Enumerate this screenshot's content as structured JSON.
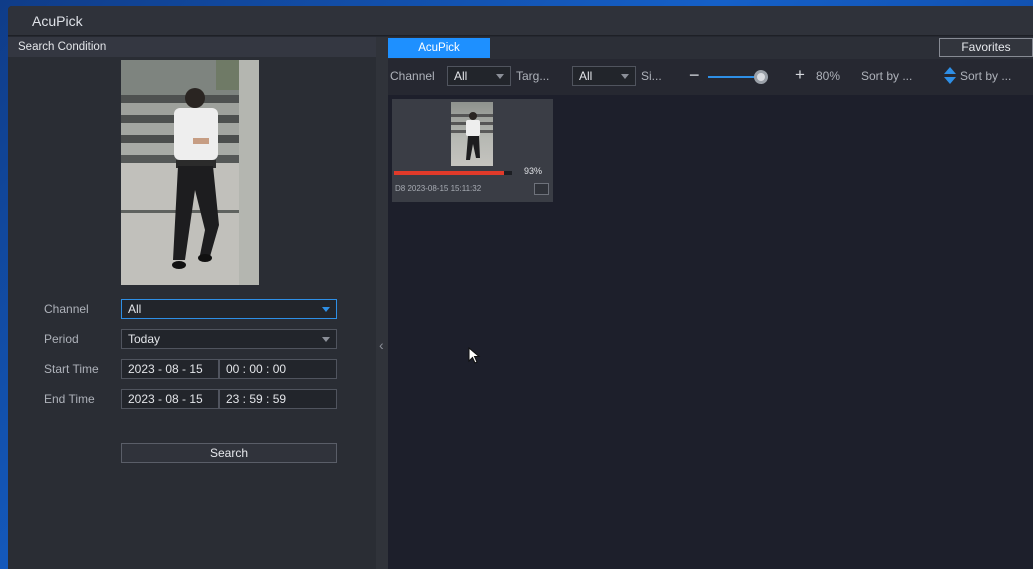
{
  "window": {
    "title": "AcuPick"
  },
  "search_panel": {
    "header": "Search Condition",
    "fields": {
      "channel": {
        "label": "Channel",
        "value": "All"
      },
      "period": {
        "label": "Period",
        "value": "Today"
      },
      "start_time": {
        "label": "Start Time",
        "date": "2023 - 08 - 15",
        "time": "00 : 00 : 00"
      },
      "end_time": {
        "label": "End Time",
        "date": "2023 - 08 - 15",
        "time": "23 : 59 : 59"
      }
    },
    "search_button": "Search",
    "collapse_icon": "chevron-left-icon"
  },
  "results_panel": {
    "tab": "AcuPick",
    "favorites_button": "Favorites",
    "toolbar": {
      "channel_label": "Channel",
      "channel_value": "All",
      "target_label": "Targ...",
      "target_value": "All",
      "size_label": "Si...",
      "zoom_value": "80%",
      "zoom_fraction": 0.8,
      "sort_by_1": "Sort by ...",
      "sort_by_2": "Sort by ..."
    },
    "results": [
      {
        "similarity": "93%",
        "similarity_value": 0.93,
        "caption": "D8 2023-08-15 15:11:32"
      }
    ]
  },
  "colors": {
    "accent": "#1e90ff",
    "progress": "#e03a2a",
    "panel": "#252830",
    "results_bg": "#1d1f2b"
  }
}
